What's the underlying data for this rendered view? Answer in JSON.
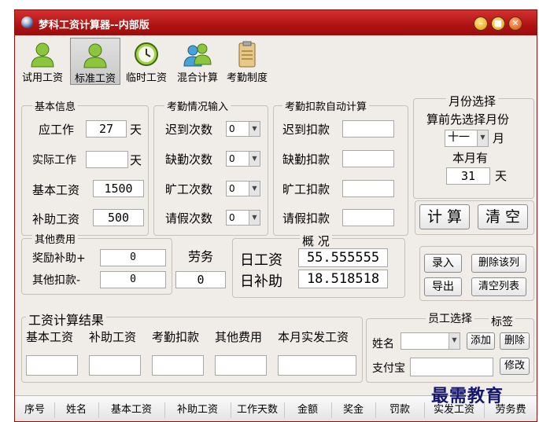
{
  "window": {
    "title": "梦科工资计算器--内部版",
    "min": "–",
    "max": "■",
    "close": "✕"
  },
  "toolbar": {
    "items": [
      {
        "label": "试用工资",
        "icon": "user-icon"
      },
      {
        "label": "标准工资",
        "icon": "user-icon"
      },
      {
        "label": "临时工资",
        "icon": "clock-icon"
      },
      {
        "label": "混合计算",
        "icon": "users-icon"
      },
      {
        "label": "考勤制度",
        "icon": "clipboard-icon"
      }
    ]
  },
  "basic": {
    "title": "基本信息",
    "should_work_label": "应工作",
    "should_work_value": "27",
    "should_work_unit": "天",
    "actual_work_label": "实际工作",
    "actual_work_value": "",
    "actual_work_unit": "天",
    "base_salary_label": "基本工资",
    "base_salary_value": "1500",
    "subsidy_label": "补助工资",
    "subsidy_value": "500"
  },
  "attendance": {
    "title": "考勤情况输入",
    "late_label": "迟到次数",
    "late_value": "0",
    "absent_label": "缺勤次数",
    "absent_value": "0",
    "truant_label": "旷工次数",
    "truant_value": "0",
    "leave_label": "请假次数",
    "leave_value": "0"
  },
  "deduction": {
    "title": "考勤扣款自动计算",
    "late_label": "迟到扣款",
    "late_value": "",
    "absent_label": "缺勤扣款",
    "absent_value": "",
    "truant_label": "旷工扣款",
    "truant_value": "",
    "leave_label": "请假扣款",
    "leave_value": ""
  },
  "month": {
    "title": "月份选择",
    "hint": "算前先选择月份",
    "value": "十一",
    "unit": "月",
    "days_label": "本月有",
    "days_value": "31",
    "days_unit": "天"
  },
  "actions": {
    "calc": "计 算",
    "clear": "清 空"
  },
  "other": {
    "title": "其他费用",
    "bonus_label": "奖励补助+",
    "bonus_value": "0",
    "other_label": "其他扣款-",
    "other_value": "0"
  },
  "labor": {
    "title": "劳务",
    "value": "0"
  },
  "overview": {
    "title": "概 况",
    "daily_label": "日工资",
    "daily_value": "55.555555",
    "subsidy_label": "日补助",
    "subsidy_value": "18.518518"
  },
  "list_actions": {
    "enter": "录入",
    "delete_row": "删除该列",
    "export": "导出",
    "clear_list": "清空列表"
  },
  "result": {
    "title": "工资计算结果",
    "cols": [
      "基本工资",
      "补助工资",
      "考勤扣款",
      "其他费用",
      "本月实发工资"
    ]
  },
  "employee": {
    "title": "员工选择",
    "tag_label": "标签",
    "name_label": "姓名",
    "name_value": "",
    "add": "添加",
    "delete": "删除",
    "alipay_label": "支付宝",
    "alipay_value": "",
    "modify": "修改"
  },
  "table": {
    "headers": [
      "序号",
      "姓名",
      "基本工资",
      "补助工资",
      "工作天数",
      "金额",
      "奖金",
      "罚款",
      "实发工资",
      "劳务费"
    ]
  },
  "watermark": "最需教育"
}
